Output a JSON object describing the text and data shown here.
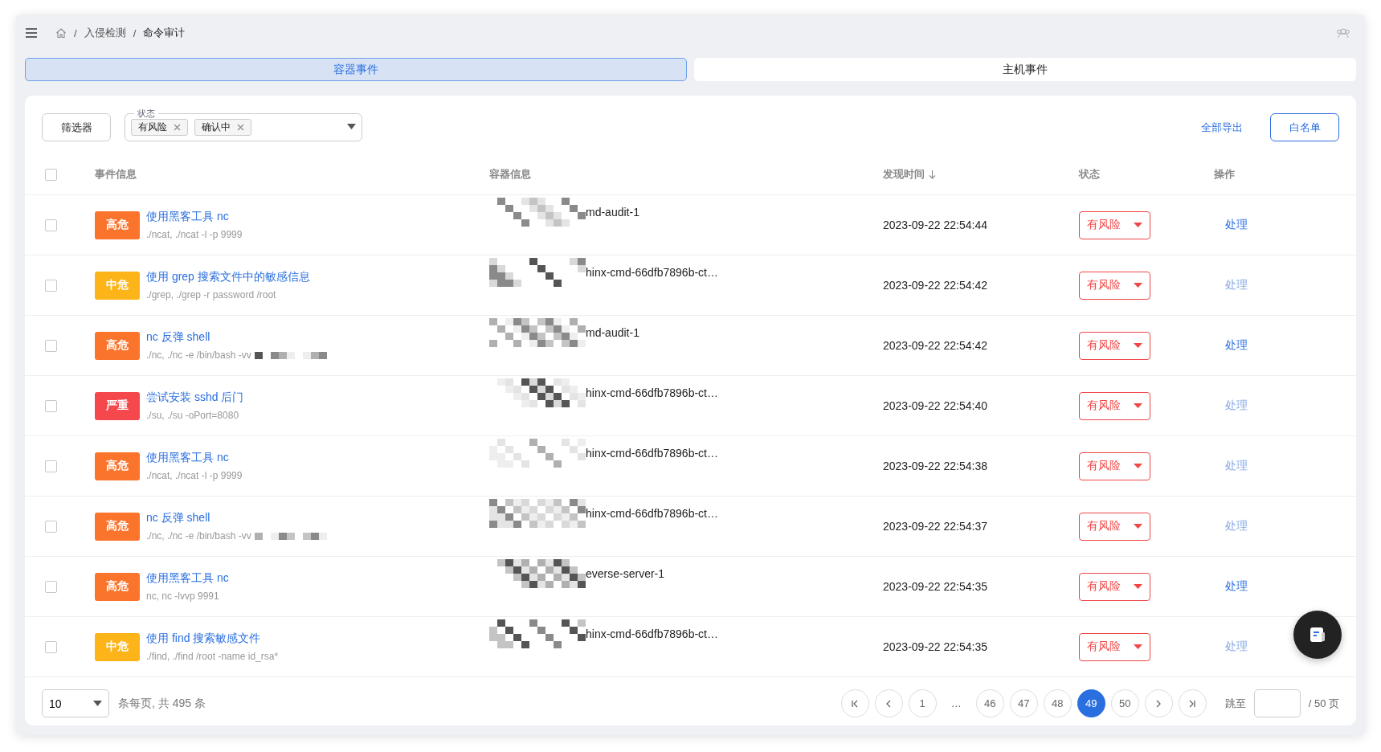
{
  "breadcrumb": [
    {
      "separator": "/",
      "label": "入侵检测"
    },
    {
      "separator": "/",
      "label": "命令审计"
    }
  ],
  "tabs": [
    {
      "label": "容器事件",
      "selected": true
    },
    {
      "label": "主机事件",
      "selected": false
    }
  ],
  "toolbar": {
    "filter_button": "筛选器",
    "status_filter": {
      "label": "状态",
      "tags": [
        "有风险",
        "确认中"
      ]
    },
    "export_link": "全部导出",
    "whitelist_button": "白名单"
  },
  "table": {
    "all_checked": false,
    "columns": [
      "事件信息",
      "容器信息",
      "发现时间",
      "状态",
      "操作"
    ],
    "rows": [
      {
        "checked": false,
        "severity": {
          "label": "高危",
          "kind": "high"
        },
        "title": "使用黑客工具 nc",
        "command": "./ncat, ./ncat -l -p 9999",
        "command_redacted": false,
        "container": "md-audit-1",
        "time": "2023-09-22 22:54:44",
        "status": "有风险",
        "action": "处理",
        "action_disabled": false
      },
      {
        "checked": false,
        "severity": {
          "label": "中危",
          "kind": "medium"
        },
        "title": "使用 grep 搜索文件中的敏感信息",
        "command": "./grep, ./grep -r password /root",
        "command_redacted": false,
        "container": "hinx-cmd-66dfb7896b-ct…",
        "time": "2023-09-22 22:54:42",
        "status": "有风险",
        "action": "处理",
        "action_disabled": true
      },
      {
        "checked": false,
        "severity": {
          "label": "高危",
          "kind": "high"
        },
        "title": "nc 反弹 shell",
        "command": "./nc, ./nc -e /bin/bash -vv",
        "command_redacted": true,
        "container": "md-audit-1",
        "time": "2023-09-22 22:54:42",
        "status": "有风险",
        "action": "处理",
        "action_disabled": false
      },
      {
        "checked": false,
        "severity": {
          "label": "严重",
          "kind": "critical"
        },
        "title": "尝试安装 sshd 后门",
        "command": "./su, ./su -oPort=8080",
        "command_redacted": false,
        "container": "hinx-cmd-66dfb7896b-ct…",
        "time": "2023-09-22 22:54:40",
        "status": "有风险",
        "action": "处理",
        "action_disabled": true
      },
      {
        "checked": false,
        "severity": {
          "label": "高危",
          "kind": "high"
        },
        "title": "使用黑客工具 nc",
        "command": "./ncat, ./ncat -l -p 9999",
        "command_redacted": false,
        "container": "hinx-cmd-66dfb7896b-ct…",
        "time": "2023-09-22 22:54:38",
        "status": "有风险",
        "action": "处理",
        "action_disabled": true
      },
      {
        "checked": false,
        "severity": {
          "label": "高危",
          "kind": "high"
        },
        "title": "nc 反弹 shell",
        "command": "./nc, ./nc -e /bin/bash -vv",
        "command_redacted": true,
        "container": "hinx-cmd-66dfb7896b-ct…",
        "time": "2023-09-22 22:54:37",
        "status": "有风险",
        "action": "处理",
        "action_disabled": true
      },
      {
        "checked": false,
        "severity": {
          "label": "高危",
          "kind": "high"
        },
        "title": "使用黑客工具 nc",
        "command": "nc, nc -lvvp 9991",
        "command_redacted": false,
        "container": "everse-server-1",
        "time": "2023-09-22 22:54:35",
        "status": "有风险",
        "action": "处理",
        "action_disabled": false
      },
      {
        "checked": false,
        "severity": {
          "label": "中危",
          "kind": "medium"
        },
        "title": "使用 find 搜索敏感文件",
        "command": "./find, ./find /root -name id_rsa*",
        "command_redacted": false,
        "container": "hinx-cmd-66dfb7896b-ct…",
        "time": "2023-09-22 22:54:35",
        "status": "有风险",
        "action": "处理",
        "action_disabled": true
      }
    ]
  },
  "pagination": {
    "page_size": "10",
    "summary": "条每页, 共 495 条",
    "pages": [
      {
        "kind": "page",
        "label": "1",
        "selected": false
      },
      {
        "kind": "ellipsis",
        "label": "…",
        "selected": false
      },
      {
        "kind": "page",
        "label": "46",
        "selected": false
      },
      {
        "kind": "page",
        "label": "47",
        "selected": false
      },
      {
        "kind": "page",
        "label": "48",
        "selected": false
      },
      {
        "kind": "page",
        "label": "49",
        "selected": true
      },
      {
        "kind": "page",
        "label": "50",
        "selected": false
      }
    ],
    "jump_label": "跳至",
    "total_pages": "/ 50 页"
  }
}
